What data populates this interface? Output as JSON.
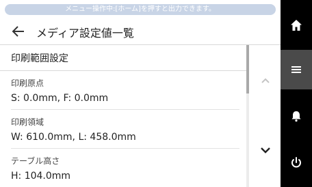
{
  "notice": {
    "text": "メニュー操作中:[ホーム]を押すと出力できます。"
  },
  "header": {
    "title": "メディア設定値一覧"
  },
  "section": {
    "title": "印刷範囲設定"
  },
  "items": [
    {
      "label": "印刷原点",
      "value": "S: 0.0mm, F: 0.0mm"
    },
    {
      "label": "印刷領域",
      "value": "W: 610.0mm, L: 458.0mm"
    },
    {
      "label": "テーブル高さ",
      "value": "H: 104.0mm"
    }
  ],
  "scroll": {
    "position_fraction": 0.0,
    "visible_fraction": 0.34
  },
  "side_nav": [
    {
      "icon": "home-icon",
      "active": false
    },
    {
      "icon": "menu-icon",
      "active": true
    },
    {
      "icon": "bell-icon",
      "active": false
    },
    {
      "icon": "power-icon",
      "active": false
    }
  ],
  "colors": {
    "notice_bg": "#c8d4e6",
    "side_bg": "#000000",
    "side_active": "#4a4a4a"
  }
}
